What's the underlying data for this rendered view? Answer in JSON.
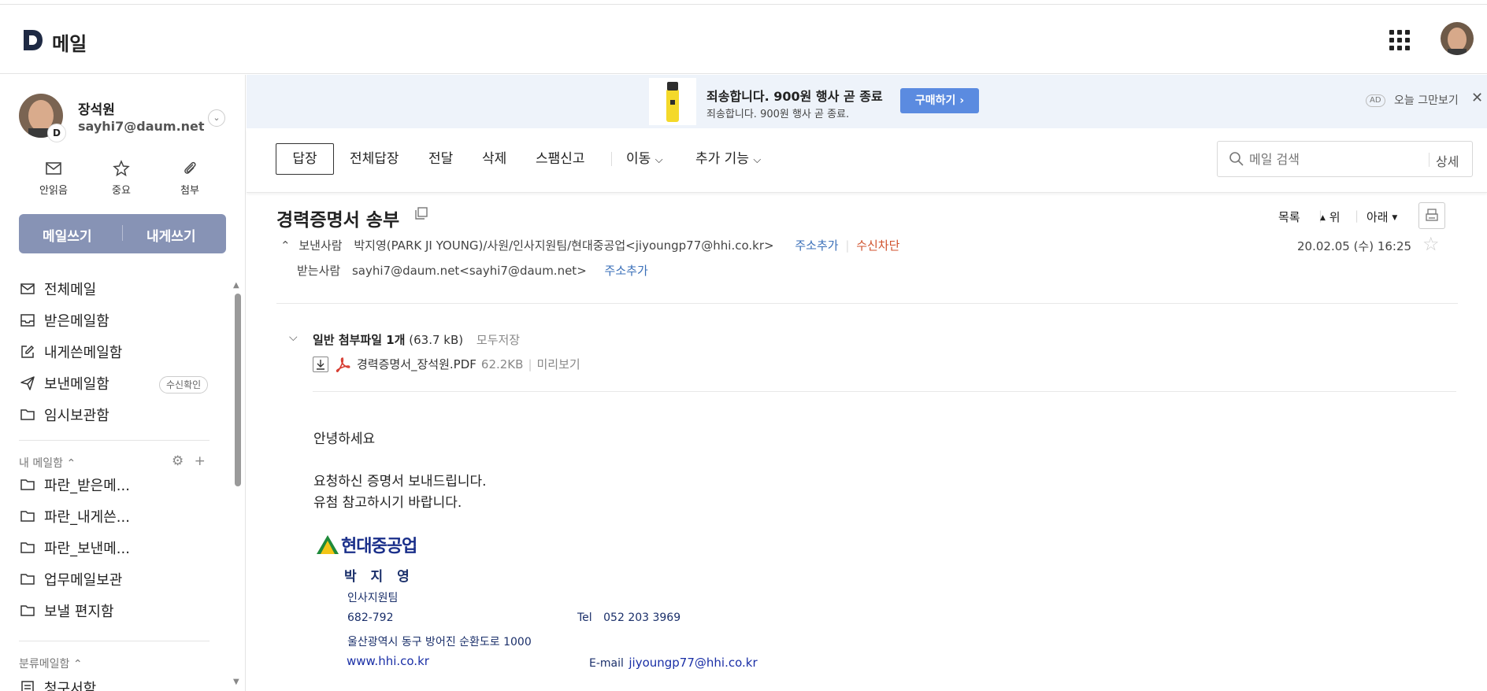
{
  "header": {
    "logo_letter": "D",
    "app_title": "메일"
  },
  "profile": {
    "badge": "D",
    "name": "장석원",
    "email": "sayhi7@daum.net"
  },
  "quick_actions": [
    {
      "label": "안읽음",
      "icon": "envelope-icon"
    },
    {
      "label": "중요",
      "icon": "star-icon"
    },
    {
      "label": "첨부",
      "icon": "paperclip-icon"
    }
  ],
  "compose": {
    "write_label": "메일쓰기",
    "self_write_label": "내게쓰기"
  },
  "mailboxes": [
    {
      "label": "전체메일",
      "icon": "mail-icon"
    },
    {
      "label": "받은메일함",
      "icon": "inbox-icon"
    },
    {
      "label": "내게쓴메일함",
      "icon": "edit-icon"
    },
    {
      "label": "보낸메일함",
      "icon": "send-icon"
    },
    {
      "label": "임시보관함",
      "icon": "folder-icon"
    }
  ],
  "read_confirm_label": "수신확인",
  "my_mailbox": {
    "header": "내 메일함",
    "folders": [
      "파란_받은메...",
      "파란_내게쓴...",
      "파란_보낸메...",
      "업무메일보관",
      "보낼 편지함"
    ]
  },
  "category_mailbox": {
    "header": "분류메일함",
    "first_item": "청구서함"
  },
  "ad": {
    "title": "죄송합니다. 900원 행사 곧 종료",
    "subtitle": "죄송합니다. 900원 행사 곧 종료.",
    "button": "구매하기",
    "tag": "AD",
    "dismiss": "오늘 그만보기"
  },
  "toolbar": {
    "reply": "답장",
    "reply_all": "전체답장",
    "forward": "전달",
    "delete": "삭제",
    "spam": "스팸신고",
    "move": "이동",
    "more": "추가 기능"
  },
  "search": {
    "placeholder": "메일 검색",
    "detail": "상세"
  },
  "message": {
    "subject": "경력증명서 송부",
    "nav_list": "목록",
    "nav_up": "위",
    "nav_down": "아래",
    "from_label": "보낸사람",
    "from_value": "박지영(PARK JI YOUNG)/사원/인사지원팀/현대중공업<jiyoungp77@hhi.co.kr>",
    "add_contact": "주소추가",
    "block": "수신차단",
    "to_label": "받는사람",
    "to_value": "sayhi7@daum.net<sayhi7@daum.net>",
    "date": "20.02.05 (수) 16:25"
  },
  "attachments": {
    "header_label": "일반 첨부파일 1개",
    "total_size": "(63.7 kB)",
    "save_all": "모두저장",
    "file_name": "경력증명서_장석원.PDF",
    "file_size": "62.2KB",
    "preview": "미리보기"
  },
  "body": {
    "greeting": "안녕하세요",
    "line1": "요청하신 증명서 보내드립니다.",
    "line2": "유첨 참고하시기 바랍니다."
  },
  "signature": {
    "company_logo": "현대중공업",
    "name": "박 지 영",
    "team": "인사지원팀",
    "postal": "682-792",
    "tel_label": "Tel",
    "tel": "052 203 3969",
    "address": "울산광역시 동구 방어진 순환도로 1000",
    "website": "www.hhi.co.kr",
    "email_label": "E-mail",
    "email": "jiyoungp77@hhi.co.kr"
  },
  "colors": {
    "compose_bg": "#8793b5",
    "ad_bg": "#eef3fa",
    "ad_button": "#5b8be0",
    "link_blue": "#3a6fb8",
    "block_red": "#d0522c",
    "signature_navy": "#1a2f6a"
  }
}
